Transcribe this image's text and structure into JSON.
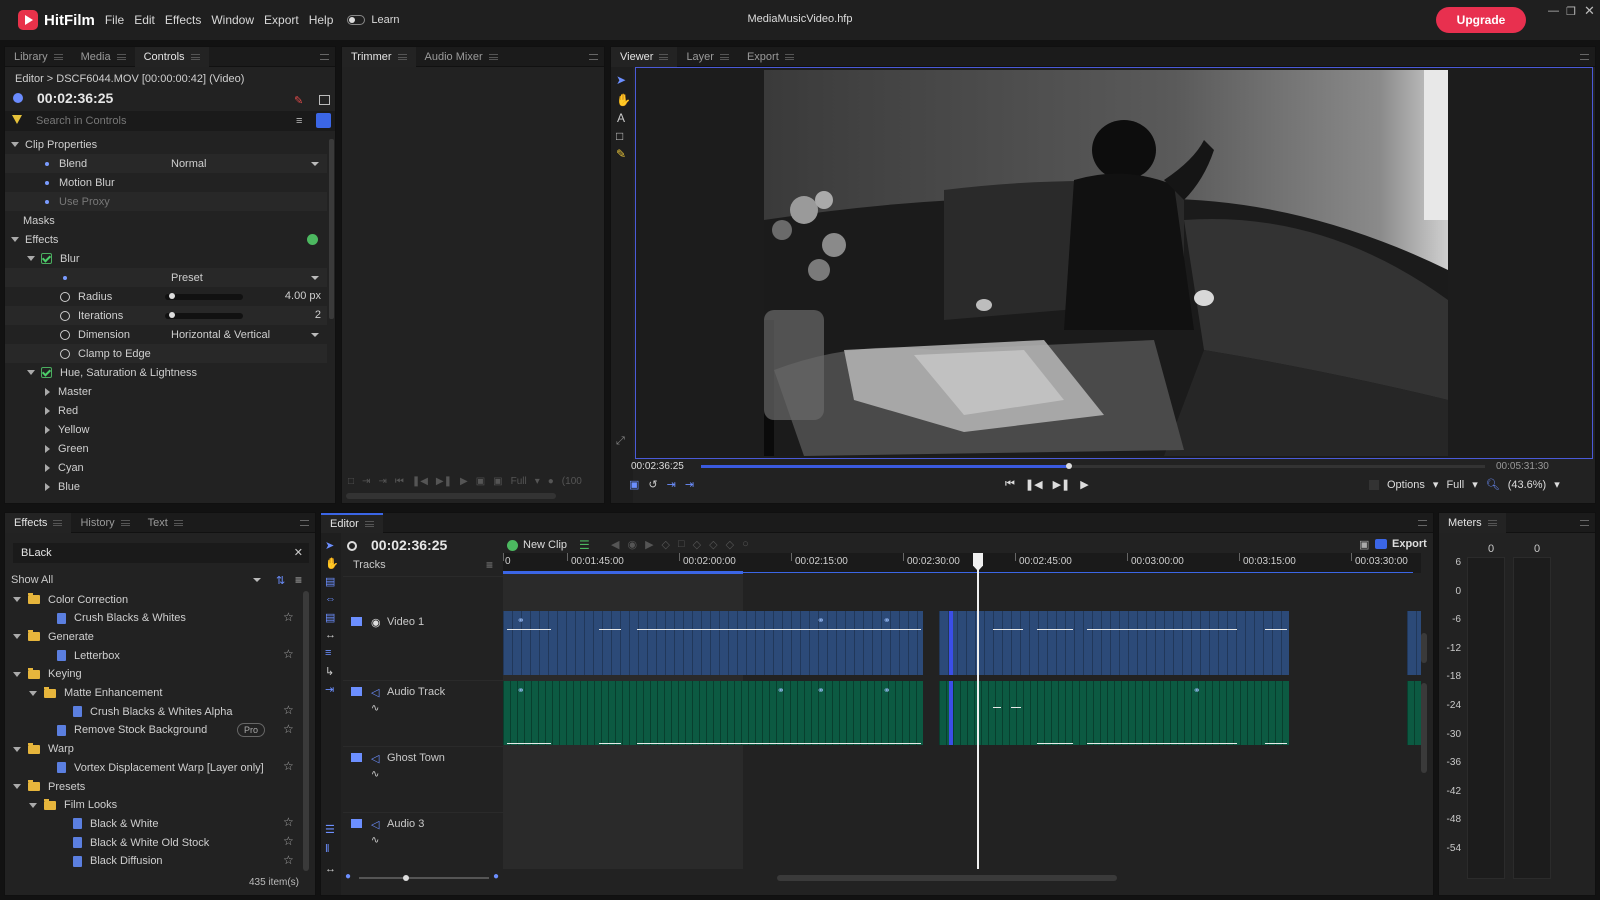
{
  "app": {
    "name": "HitFilm",
    "menu": [
      "File",
      "Edit",
      "Effects",
      "Window",
      "Export",
      "Help"
    ],
    "learn_label": "Learn",
    "doc_title": "MediaMusicVideo.hfp",
    "upgrade_label": "Upgrade",
    "accent": "#e8304f"
  },
  "controls_panel": {
    "tabs": [
      "Library",
      "Media",
      "Controls"
    ],
    "breadcrumb": "Editor > DSCF6044.MOV [00:00:00:42] (Video)",
    "timecode": "00:02:36:25",
    "search_placeholder": "Search in Controls",
    "sections": {
      "clip_properties": "Clip Properties",
      "blend_label": "Blend",
      "blend_value": "Normal",
      "motion_blur": "Motion Blur",
      "use_proxy": "Use Proxy",
      "masks": "Masks",
      "effects": "Effects",
      "blur": "Blur",
      "preset": "Preset",
      "radius_label": "Radius",
      "radius_value": "4.00 px",
      "radius_fraction": 0.05,
      "iterations_label": "Iterations",
      "iterations_value": "2",
      "iterations_fraction": 0.05,
      "dimension_label": "Dimension",
      "dimension_value": "Horizontal & Vertical",
      "clamp_label": "Clamp to Edge",
      "hsl": "Hue, Saturation & Lightness",
      "hsl_children": [
        "Master",
        "Red",
        "Yellow",
        "Green",
        "Cyan",
        "Blue"
      ]
    }
  },
  "trimmer_panel": {
    "tabs": [
      "Trimmer",
      "Audio Mixer"
    ],
    "quality": "Full",
    "zoom": "(100"
  },
  "viewer_panel": {
    "tabs": [
      "Viewer",
      "Layer",
      "Export"
    ],
    "current_time": "00:02:36:25",
    "end_time": "00:05:31:30",
    "progress": 0.47,
    "options_label": "Options",
    "quality": "Full",
    "zoom": "(43.6%)"
  },
  "effects_panel": {
    "tabs": [
      "Effects",
      "History",
      "Text"
    ],
    "search_value": "BLack",
    "filter": "Show All",
    "count": "435 item(s)",
    "pro_badge": "Pro",
    "tree": [
      {
        "type": "folder",
        "label": "Color Correction",
        "level": 0
      },
      {
        "type": "effect",
        "label": "Crush Blacks & Whites",
        "level": 1
      },
      {
        "type": "folder",
        "label": "Generate",
        "level": 0
      },
      {
        "type": "effect",
        "label": "Letterbox",
        "level": 1
      },
      {
        "type": "folder",
        "label": "Keying",
        "level": 0
      },
      {
        "type": "folder",
        "label": "Matte Enhancement",
        "level": 1
      },
      {
        "type": "effect",
        "label": "Crush Blacks & Whites Alpha",
        "level": 2
      },
      {
        "type": "effect",
        "label": "Remove Stock Background",
        "level": 1,
        "pro": true
      },
      {
        "type": "folder",
        "label": "Warp",
        "level": 0
      },
      {
        "type": "effect",
        "label": "Vortex Displacement Warp [Layer only]",
        "level": 1
      },
      {
        "type": "folder",
        "label": "Presets",
        "level": 0
      },
      {
        "type": "folder",
        "label": "Film Looks",
        "level": 1
      },
      {
        "type": "effect",
        "label": "Black & White",
        "level": 2
      },
      {
        "type": "effect",
        "label": "Black & White Old Stock",
        "level": 2
      },
      {
        "type": "effect",
        "label": "Black Diffusion",
        "level": 2
      }
    ]
  },
  "editor_panel": {
    "tab": "Editor",
    "timecode": "00:02:36:25",
    "new_clip_label": "New Clip",
    "export_label": "Export",
    "tracks_label": "Tracks",
    "ruler": [
      "0",
      "00:01:45:00",
      "00:02:00:00",
      "00:02:15:00",
      "00:02:30:00",
      "00:02:45:00",
      "00:03:00:00",
      "00:03:15:00",
      "00:03:30:00"
    ],
    "tracks": [
      "Video 1",
      "Audio Track",
      "Ghost Town",
      "Audio 3"
    ]
  },
  "meters_panel": {
    "tab": "Meters",
    "channels": [
      "0",
      "0"
    ],
    "scale": [
      "6",
      "0",
      "-6",
      "-12",
      "-18",
      "-24",
      "-30",
      "-36",
      "-42",
      "-48",
      "-54"
    ]
  }
}
